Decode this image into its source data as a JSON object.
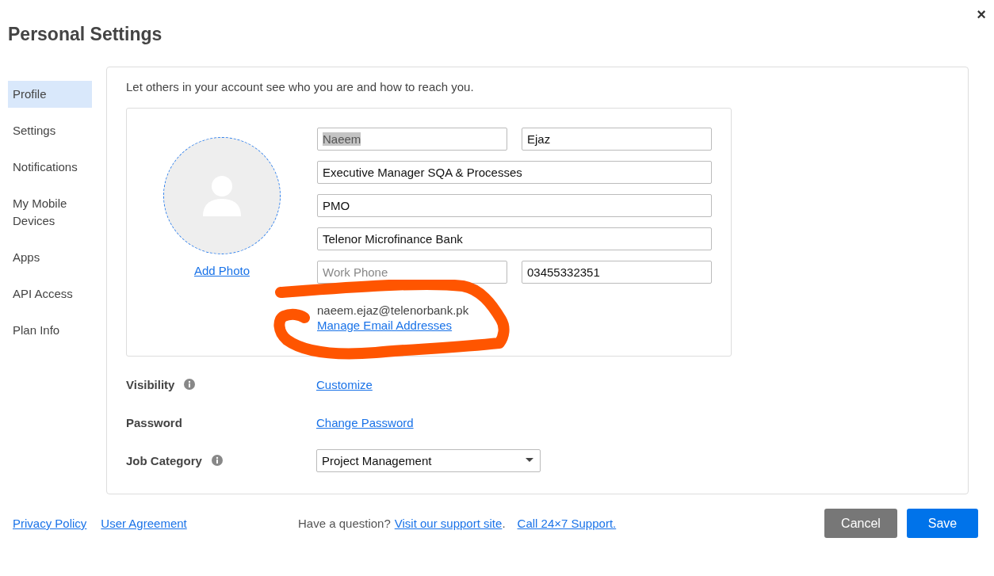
{
  "window": {
    "title": "Personal Settings",
    "close": "×"
  },
  "sidebar": {
    "items": [
      {
        "label": "Profile",
        "selected": true
      },
      {
        "label": "Settings",
        "selected": false
      },
      {
        "label": "Notifications",
        "selected": false
      },
      {
        "label": "My Mobile Devices",
        "selected": false
      },
      {
        "label": "Apps",
        "selected": false
      },
      {
        "label": "API Access",
        "selected": false
      },
      {
        "label": "Plan Info",
        "selected": false
      }
    ]
  },
  "profile": {
    "intro": "Let others in your account see who you are and how to reach you.",
    "add_photo": "Add Photo",
    "field_rows": [
      [
        {
          "value": "Naeem",
          "highlighted": true
        },
        {
          "value": "Ejaz",
          "highlighted": false
        }
      ],
      [
        {
          "value": "Executive Manager SQA & Processes",
          "highlighted": false
        }
      ],
      [
        {
          "value": "PMO",
          "highlighted": false
        }
      ],
      [
        {
          "value": "Telenor Microfinance Bank",
          "highlighted": false
        }
      ],
      [
        {
          "placeholder": "Work Phone"
        },
        {
          "value": "03455332351",
          "highlighted": false
        }
      ]
    ],
    "email": "naeem.ejaz@telenorbank.pk",
    "manage_email": "Manage Email Addresses",
    "annotations": [
      {
        "kind": "scribble",
        "color": "#ff5500"
      }
    ]
  },
  "settings_rows": [
    {
      "label": "Visibility",
      "info": true,
      "kind": "link",
      "value": "Customize"
    },
    {
      "label": "Password",
      "info": false,
      "kind": "link",
      "value": "Change Password"
    },
    {
      "label": "Job Category",
      "info": true,
      "kind": "dropdown",
      "value": "Project Management"
    }
  ],
  "footer": {
    "links": [
      "Privacy Policy",
      "User Agreement"
    ],
    "question": "Have a question?",
    "support_link": "Visit our support site",
    "separator": ".",
    "call_link": "Call 24×7 Support.",
    "buttons": [
      {
        "label": "Cancel",
        "kind": "secondary"
      },
      {
        "label": "Save",
        "kind": "primary"
      }
    ]
  }
}
